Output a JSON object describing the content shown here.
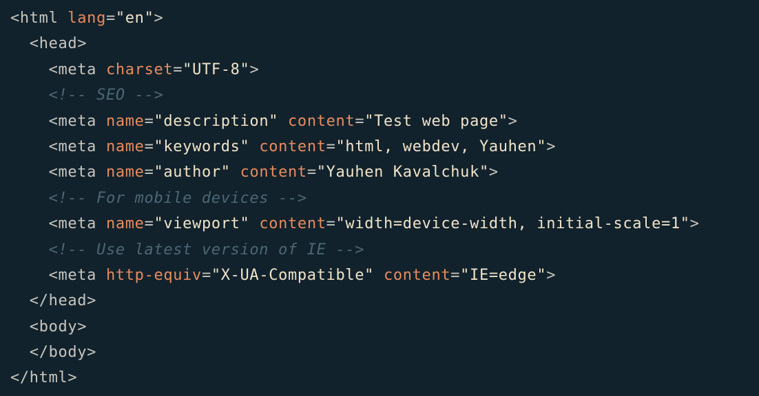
{
  "colors": {
    "background": "#11222c",
    "tag": "#c8c5bf",
    "attribute": "#e98b5e",
    "string": "#f1e3c9",
    "comment": "#4c6775"
  },
  "code": {
    "lines": [
      {
        "indent": 0,
        "tokens": [
          {
            "type": "tag",
            "text": "<html"
          },
          {
            "type": "text",
            "text": " "
          },
          {
            "type": "attr",
            "text": "lang"
          },
          {
            "type": "eq",
            "text": "="
          },
          {
            "type": "str",
            "text": "\"en\""
          },
          {
            "type": "tag",
            "text": ">"
          }
        ]
      },
      {
        "indent": 1,
        "tokens": [
          {
            "type": "tag",
            "text": "<head>"
          }
        ]
      },
      {
        "indent": 2,
        "tokens": [
          {
            "type": "tag",
            "text": "<meta"
          },
          {
            "type": "text",
            "text": " "
          },
          {
            "type": "attr",
            "text": "charset"
          },
          {
            "type": "eq",
            "text": "="
          },
          {
            "type": "str",
            "text": "\"UTF-8\""
          },
          {
            "type": "tag",
            "text": ">"
          }
        ]
      },
      {
        "indent": 2,
        "tokens": [
          {
            "type": "comment",
            "text": "<!-- SEO -->"
          }
        ]
      },
      {
        "indent": 2,
        "tokens": [
          {
            "type": "tag",
            "text": "<meta"
          },
          {
            "type": "text",
            "text": " "
          },
          {
            "type": "attr",
            "text": "name"
          },
          {
            "type": "eq",
            "text": "="
          },
          {
            "type": "str",
            "text": "\"description\""
          },
          {
            "type": "text",
            "text": " "
          },
          {
            "type": "attr",
            "text": "content"
          },
          {
            "type": "eq",
            "text": "="
          },
          {
            "type": "str",
            "text": "\"Test web page\""
          },
          {
            "type": "tag",
            "text": ">"
          }
        ]
      },
      {
        "indent": 2,
        "tokens": [
          {
            "type": "tag",
            "text": "<meta"
          },
          {
            "type": "text",
            "text": " "
          },
          {
            "type": "attr",
            "text": "name"
          },
          {
            "type": "eq",
            "text": "="
          },
          {
            "type": "str",
            "text": "\"keywords\""
          },
          {
            "type": "text",
            "text": " "
          },
          {
            "type": "attr",
            "text": "content"
          },
          {
            "type": "eq",
            "text": "="
          },
          {
            "type": "str",
            "text": "\"html, webdev, Yauhen\""
          },
          {
            "type": "tag",
            "text": ">"
          }
        ]
      },
      {
        "indent": 2,
        "tokens": [
          {
            "type": "tag",
            "text": "<meta"
          },
          {
            "type": "text",
            "text": " "
          },
          {
            "type": "attr",
            "text": "name"
          },
          {
            "type": "eq",
            "text": "="
          },
          {
            "type": "str",
            "text": "\"author\""
          },
          {
            "type": "text",
            "text": " "
          },
          {
            "type": "attr",
            "text": "content"
          },
          {
            "type": "eq",
            "text": "="
          },
          {
            "type": "str",
            "text": "\"Yauhen Kavalchuk\""
          },
          {
            "type": "tag",
            "text": ">"
          }
        ]
      },
      {
        "indent": 2,
        "tokens": [
          {
            "type": "comment",
            "text": "<!-- For mobile devices -->"
          }
        ]
      },
      {
        "indent": 2,
        "tokens": [
          {
            "type": "tag",
            "text": "<meta"
          },
          {
            "type": "text",
            "text": " "
          },
          {
            "type": "attr",
            "text": "name"
          },
          {
            "type": "eq",
            "text": "="
          },
          {
            "type": "str",
            "text": "\"viewport\""
          },
          {
            "type": "text",
            "text": " "
          },
          {
            "type": "attr",
            "text": "content"
          },
          {
            "type": "eq",
            "text": "="
          },
          {
            "type": "str",
            "text": "\"width=device-width, initial-scale=1\""
          },
          {
            "type": "tag",
            "text": ">"
          }
        ]
      },
      {
        "indent": 2,
        "tokens": [
          {
            "type": "comment",
            "text": "<!-- Use latest version of IE -->"
          }
        ]
      },
      {
        "indent": 2,
        "tokens": [
          {
            "type": "tag",
            "text": "<meta"
          },
          {
            "type": "text",
            "text": " "
          },
          {
            "type": "attr",
            "text": "http-equiv"
          },
          {
            "type": "eq",
            "text": "="
          },
          {
            "type": "str",
            "text": "\"X-UA-Compatible\""
          },
          {
            "type": "text",
            "text": " "
          },
          {
            "type": "attr",
            "text": "content"
          },
          {
            "type": "eq",
            "text": "="
          },
          {
            "type": "str",
            "text": "\"IE=edge\""
          },
          {
            "type": "tag",
            "text": ">"
          }
        ]
      },
      {
        "indent": 1,
        "tokens": [
          {
            "type": "tag",
            "text": "</head>"
          }
        ]
      },
      {
        "indent": 1,
        "tokens": [
          {
            "type": "tag",
            "text": "<body>"
          }
        ]
      },
      {
        "indent": 1,
        "tokens": [
          {
            "type": "tag",
            "text": "</body>"
          }
        ]
      },
      {
        "indent": 0,
        "tokens": [
          {
            "type": "tag",
            "text": "</html>"
          }
        ]
      }
    ]
  }
}
